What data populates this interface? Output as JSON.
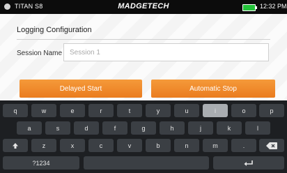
{
  "status": {
    "device": "TITAN S8",
    "brand": "MADGETECH",
    "time": "12:32 PM"
  },
  "config": {
    "title": "Logging Configuration",
    "session_label": "Session Name",
    "session_value": "",
    "session_placeholder": "Session 1"
  },
  "buttons": {
    "delayed": "Delayed Start",
    "auto": "Automatic Stop"
  },
  "keyboard": {
    "row1": [
      "q",
      "w",
      "e",
      "r",
      "t",
      "y",
      "u",
      "i",
      "o",
      "p"
    ],
    "row2": [
      "a",
      "s",
      "d",
      "f",
      "g",
      "h",
      "j",
      "k",
      "l"
    ],
    "row3": [
      "z",
      "x",
      "c",
      "v",
      "b",
      "n",
      "m",
      "."
    ],
    "mode": "?1234",
    "active_key": "i"
  },
  "colors": {
    "accent": "#ee842a",
    "battery": "#24c23a"
  }
}
